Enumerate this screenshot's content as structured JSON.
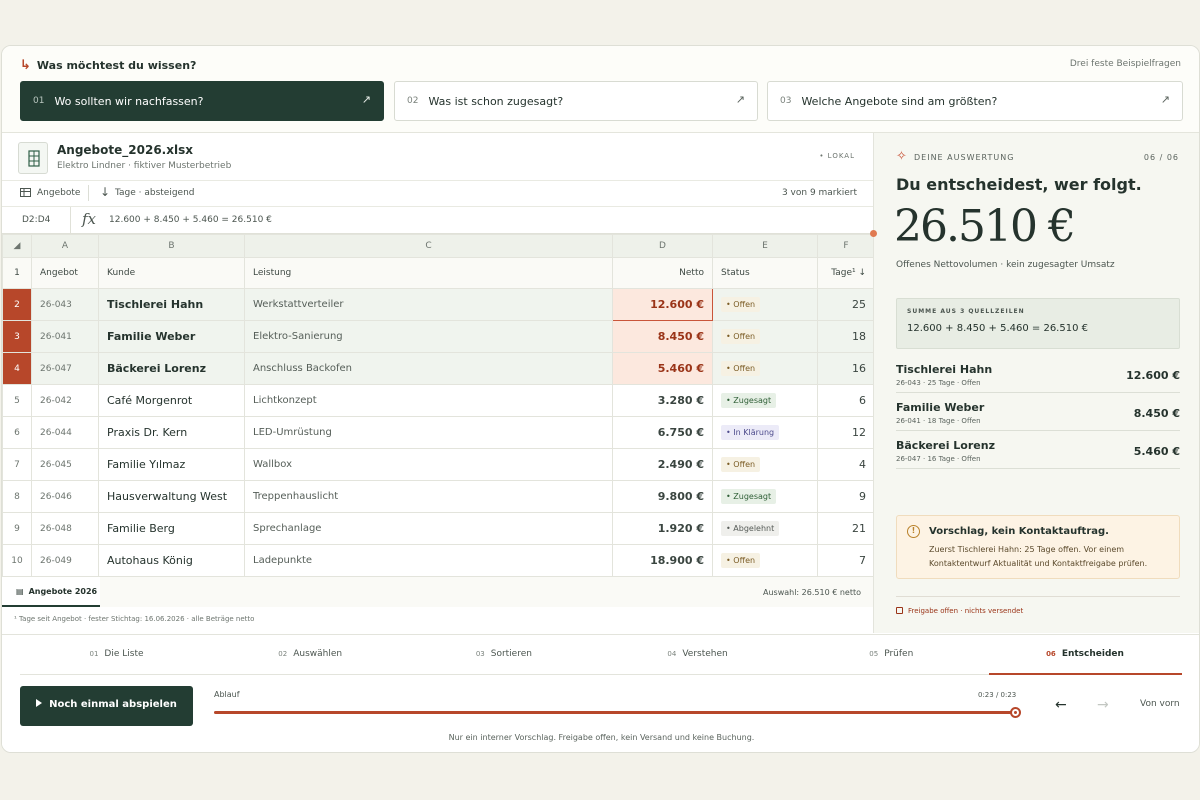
{
  "question_bar": {
    "title": "Was möchtest du wissen?",
    "hint": "Drei feste Beispielfragen",
    "questions": [
      {
        "num": "01",
        "label": "Wo sollten wir nachfassen?",
        "active": true
      },
      {
        "num": "02",
        "label": "Was ist schon zugesagt?",
        "active": false
      },
      {
        "num": "03",
        "label": "Welche Angebote sind am größten?",
        "active": false
      }
    ]
  },
  "file": {
    "name": "Angebote_2026.xlsx",
    "subtitle": "Elektro Lindner · fiktiver Musterbetrieb",
    "source": "• LOKAL"
  },
  "toolbar": {
    "sheet": "Angebote",
    "sort": "Tage · absteigend",
    "marked": "3 von 9 markiert"
  },
  "formula": {
    "cell_ref": "D2:D4",
    "fx": "fx",
    "expression": "12.600 + 8.450 + 5.460 = 26.510 €"
  },
  "grid": {
    "col_letters": [
      "A",
      "B",
      "C",
      "D",
      "E",
      "F"
    ],
    "header_row_num": "1",
    "headers": {
      "angebot": "Angebot",
      "kunde": "Kunde",
      "leistung": "Leistung",
      "netto": "Netto",
      "status": "Status",
      "tage": "Tage¹ ↓"
    },
    "rows": [
      {
        "rn": "2",
        "id": "26-043",
        "kunde": "Tischlerei Hahn",
        "leistung": "Werkstattverteiler",
        "netto": "12.600 €",
        "status": "Offen",
        "status_kind": "off",
        "tage": "25",
        "sel": true
      },
      {
        "rn": "3",
        "id": "26-041",
        "kunde": "Familie Weber",
        "leistung": "Elektro-Sanierung",
        "netto": "8.450 €",
        "status": "Offen",
        "status_kind": "off",
        "tage": "18",
        "sel": true
      },
      {
        "rn": "4",
        "id": "26-047",
        "kunde": "Bäckerei Lorenz",
        "leistung": "Anschluss Backofen",
        "netto": "5.460 €",
        "status": "Offen",
        "status_kind": "off",
        "tage": "16",
        "sel": true
      },
      {
        "rn": "5",
        "id": "26-042",
        "kunde": "Café Morgenrot",
        "leistung": "Lichtkonzept",
        "netto": "3.280 €",
        "status": "Zugesagt",
        "status_kind": "zu",
        "tage": "6",
        "sel": false
      },
      {
        "rn": "6",
        "id": "26-044",
        "kunde": "Praxis Dr. Kern",
        "leistung": "LED-Umrüstung",
        "netto": "6.750 €",
        "status": "In Klärung",
        "status_kind": "kl",
        "tage": "12",
        "sel": false
      },
      {
        "rn": "7",
        "id": "26-045",
        "kunde": "Familie Yılmaz",
        "leistung": "Wallbox",
        "netto": "2.490 €",
        "status": "Offen",
        "status_kind": "off",
        "tage": "4",
        "sel": false
      },
      {
        "rn": "8",
        "id": "26-046",
        "kunde": "Hausverwaltung West",
        "leistung": "Treppenhauslicht",
        "netto": "9.800 €",
        "status": "Zugesagt",
        "status_kind": "zu",
        "tage": "9",
        "sel": false
      },
      {
        "rn": "9",
        "id": "26-048",
        "kunde": "Familie Berg",
        "leistung": "Sprechanlage",
        "netto": "1.920 €",
        "status": "Abgelehnt",
        "status_kind": "ab",
        "tage": "21",
        "sel": false
      },
      {
        "rn": "10",
        "id": "26-049",
        "kunde": "Autohaus König",
        "leistung": "Ladepunkte",
        "netto": "18.900 €",
        "status": "Offen",
        "status_kind": "off",
        "tage": "7",
        "sel": false
      }
    ]
  },
  "sheet_tab": "Angebote 2026",
  "selection_sum": "Auswahl: 26.510 € netto",
  "footnote": "¹ Tage seit Angebot · fester Stichtag: 16.06.2026 · alle Beträge netto",
  "panel": {
    "tag": "DEINE AUSWERTUNG",
    "counter": "06 / 06",
    "title": "Du entscheidest, wer folgt.",
    "big_value": "26.510 €",
    "subtitle": "Offenes Nettovolumen · kein zugesagter Umsatz",
    "sum_title": "SUMME AUS 3 QUELLZEILEN",
    "sum_value": "12.600 + 8.450 + 5.460 = 26.510 €",
    "items": [
      {
        "name": "Tischlerei Hahn",
        "meta": "26-043 · 25 Tage · Offen",
        "amount": "12.600 €"
      },
      {
        "name": "Familie Weber",
        "meta": "26-041 · 18 Tage · Offen",
        "amount": "8.450 €"
      },
      {
        "name": "Bäckerei Lorenz",
        "meta": "26-047 · 16 Tage · Offen",
        "amount": "5.460 €"
      }
    ],
    "advice_title": "Vorschlag, kein Kontaktauftrag.",
    "advice_text": "Zuerst Tischlerei Hahn: 25 Tage offen. Vor einem Kontaktentwurf Aktualität und Kontaktfreigabe prüfen.",
    "release": "Freigabe offen · nichts versendet"
  },
  "player": {
    "steps": [
      {
        "num": "01",
        "label": "Die Liste"
      },
      {
        "num": "02",
        "label": "Auswählen"
      },
      {
        "num": "03",
        "label": "Sortieren"
      },
      {
        "num": "04",
        "label": "Verstehen"
      },
      {
        "num": "05",
        "label": "Prüfen"
      },
      {
        "num": "06",
        "label": "Entscheiden"
      }
    ],
    "active_step": 5,
    "replay": "Noch einmal abspielen",
    "ablauf": "Ablauf",
    "time": "0:23 / 0:23",
    "progress": 1.0,
    "prev": "←",
    "next": "→",
    "restart": "Von vorn",
    "note": "Nur ein interner Vorschlag. Freigabe offen, kein Versand und keine Buchung."
  }
}
